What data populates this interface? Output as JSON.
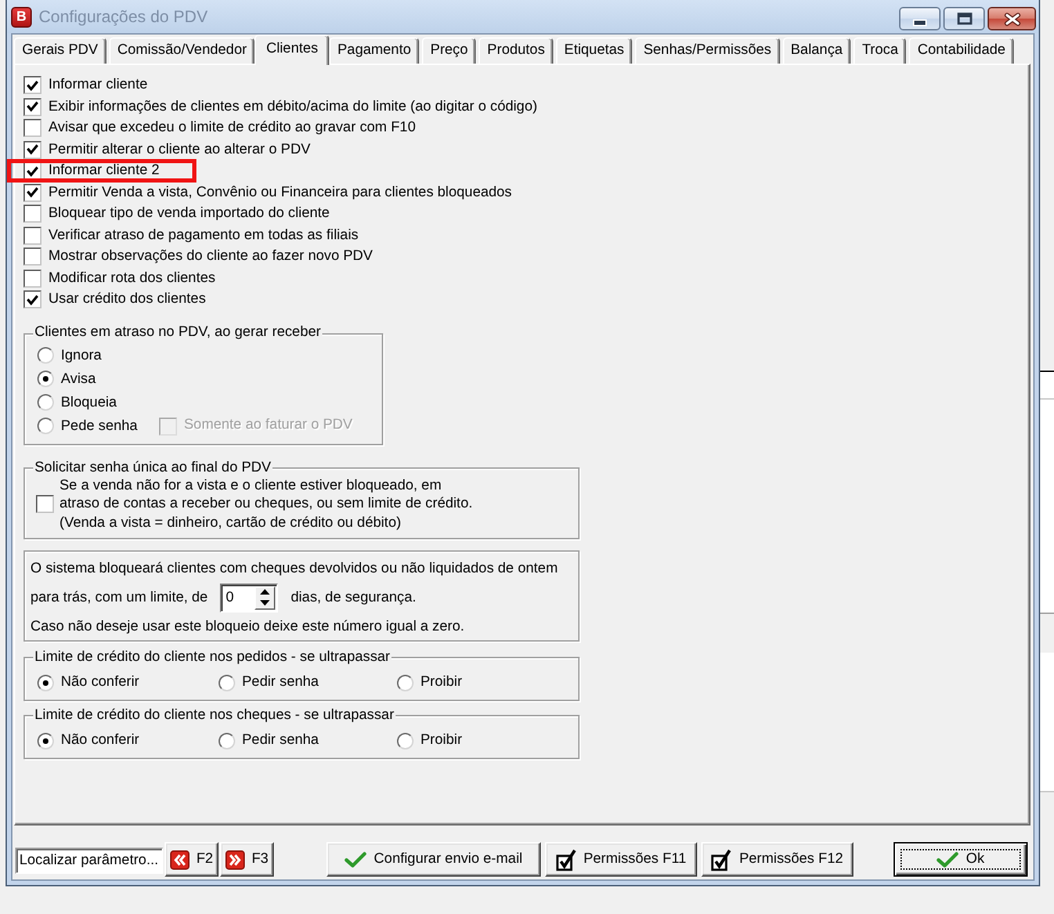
{
  "window": {
    "icon_letter": "B",
    "title": "Configurações do PDV"
  },
  "tabs": [
    {
      "label": "Gerais PDV",
      "selected": false
    },
    {
      "label": "Comissão/Vendedor",
      "selected": false
    },
    {
      "label": "Clientes",
      "selected": true
    },
    {
      "label": "Pagamento",
      "selected": false
    },
    {
      "label": "Preço",
      "selected": false
    },
    {
      "label": "Produtos",
      "selected": false
    },
    {
      "label": "Etiquetas",
      "selected": false
    },
    {
      "label": "Senhas/Permissões",
      "selected": false
    },
    {
      "label": "Balança",
      "selected": false
    },
    {
      "label": "Troca",
      "selected": false
    },
    {
      "label": "Contabilidade",
      "selected": false
    }
  ],
  "options": [
    {
      "label": "Informar cliente",
      "checked": true,
      "highlighted": false
    },
    {
      "label": "Exibir informações de clientes em débito/acima do limite (ao digitar o código)",
      "checked": true,
      "highlighted": false
    },
    {
      "label": "Avisar que excedeu o limite de crédito ao gravar com F10",
      "checked": false,
      "highlighted": false
    },
    {
      "label": "Permitir alterar o cliente ao alterar o PDV",
      "checked": true,
      "highlighted": false
    },
    {
      "label": "Informar cliente 2",
      "checked": true,
      "highlighted": true
    },
    {
      "label": "Permitir Venda a vista, Convênio ou Financeira para clientes bloqueados",
      "checked": true,
      "highlighted": false
    },
    {
      "label": "Bloquear tipo de venda importado do cliente",
      "checked": false,
      "highlighted": false
    },
    {
      "label": "Verificar atraso de pagamento em todas as filiais",
      "checked": false,
      "highlighted": false
    },
    {
      "label": "Mostrar observações do cliente ao fazer novo PDV",
      "checked": false,
      "highlighted": false
    },
    {
      "label": "Modificar rota dos clientes",
      "checked": false,
      "highlighted": false
    },
    {
      "label": "Usar crédito dos clientes",
      "checked": true,
      "highlighted": false
    }
  ],
  "overdue_group": {
    "title": "Clientes em atraso no PDV, ao gerar receber",
    "choices": [
      {
        "label": "Ignora",
        "selected": false
      },
      {
        "label": "Avisa",
        "selected": true
      },
      {
        "label": "Bloqueia",
        "selected": false
      },
      {
        "label": "Pede senha",
        "selected": false,
        "option": {
          "label": "Somente ao faturar o PDV",
          "checked": false,
          "disabled": true
        }
      }
    ]
  },
  "single_password_group": {
    "title": "Solicitar senha única ao final do PDV",
    "checked": false,
    "lines": [
      "Se a venda não for a vista e o cliente estiver bloqueado, em",
      "atraso de contas a receber ou cheques, ou sem limite de crédito.",
      "(Venda a vista = dinheiro, cartão de crédito ou débito)"
    ]
  },
  "returned_cheques": {
    "line_1": "O sistema bloqueará clientes com cheques devolvidos ou não liquidados de ontem",
    "days_prefix": "para trás, com um limite, de",
    "days": "0",
    "days_suffix": "dias, de segurança.",
    "note": "Caso não deseje usar este bloqueio deixe este número igual a zero."
  },
  "credit_limit_groups": [
    {
      "title": "Limite de crédito do cliente nos pedidos - se ultrapassar",
      "choices": [
        {
          "label": "Não conferir",
          "selected": true
        },
        {
          "label": "Pedir senha",
          "selected": false
        },
        {
          "label": "Proibir",
          "selected": false
        }
      ]
    },
    {
      "title": "Limite de crédito do cliente nos cheques - se ultrapassar",
      "choices": [
        {
          "label": "Não conferir",
          "selected": true
        },
        {
          "label": "Pedir senha",
          "selected": false
        },
        {
          "label": "Proibir",
          "selected": false
        }
      ]
    }
  ],
  "footer": {
    "search": {
      "value": "Localizar parâmetro..."
    },
    "buttons": [
      {
        "kind": "previous",
        "label": "F2",
        "default": false
      },
      {
        "kind": "next",
        "label": "F3",
        "default": false
      },
      {
        "kind": "email",
        "label": "Configurar envio e-mail",
        "default": false
      },
      {
        "kind": "permissions",
        "label": "Permissões F11",
        "default": false
      },
      {
        "kind": "permissions",
        "label": "Permissões F12",
        "default": false
      },
      {
        "kind": "ok",
        "label": "Ok",
        "default": true
      }
    ]
  }
}
